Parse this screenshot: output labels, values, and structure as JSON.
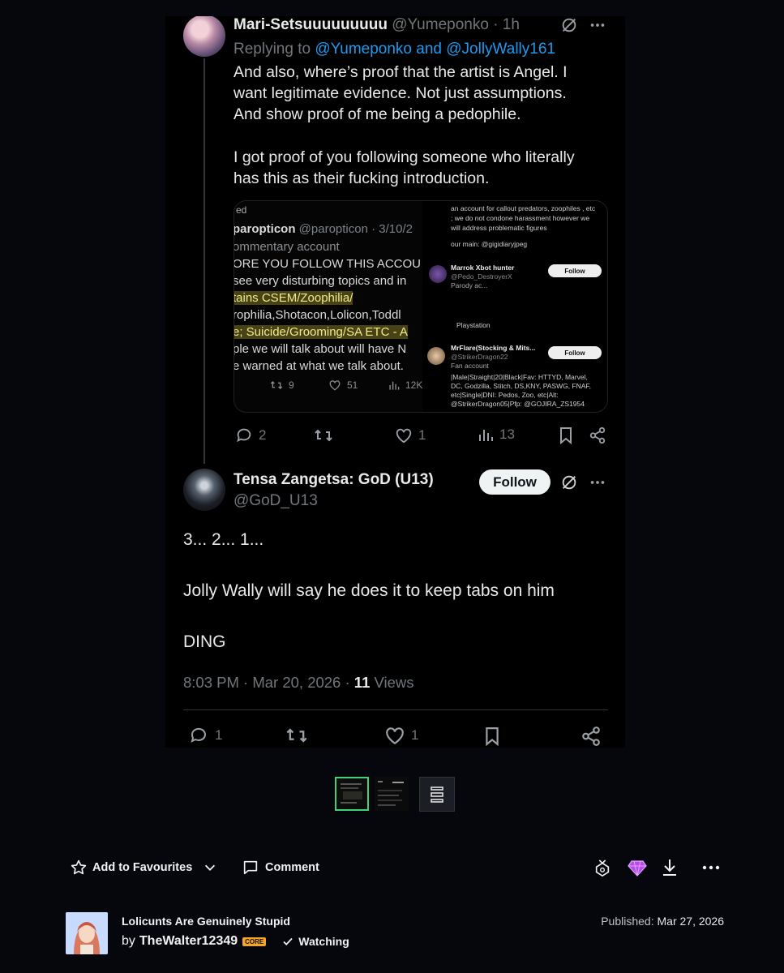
{
  "tweet1": {
    "author": "Mari-Setsuuuuuuuuu",
    "handle": "@Yumeponko",
    "time": "· 1h",
    "replying_prefix": "Replying to",
    "replying_to": "@Yumeponko and @JollyWally161",
    "lines": [
      "And also, where’s proof that the artist is Angel. I",
      "want legitimate evidence. Not just assumptions.",
      "And show proof of me being a pedophile.",
      "I got proof of you following someone who literally",
      "has this as their fucking introduction."
    ],
    "stats": {
      "replies": "2",
      "likes": "1",
      "views": "13"
    }
  },
  "quoted_image": {
    "left": {
      "top_label": "ed",
      "name": "paropticon",
      "handle_time": "@paropticon · 3/10/2",
      "lines": [
        "ommentary account",
        "ORE YOU FOLLOW THIS ACCOU",
        "see very disturbing topics and in",
        "tains CSEM/Zoophilia/",
        "rophilia,Shotacon,Lolicon,Toddl",
        "e; Suicide/Grooming/SA ETC - A",
        "ple we will talk about will have N",
        "e warned at what we talk about."
      ],
      "stats": {
        "retweets": "9",
        "likes": "51",
        "views": "12K"
      }
    },
    "right": {
      "intro_lines": [
        "an account for callout predators, zoophiles , etc",
        "; we do not condone harassment however we",
        "will address problematic figures",
        "our main: @gigidiaryjpeg"
      ],
      "user1_name": "Marrok Xbot hunter",
      "user1_handle": "@Pedo_DestroyerX",
      "user1_bio": "Parody ac...",
      "user1_extra": "Playstation",
      "user2_name": "MrFlare(Stocking & Mits...",
      "user2_handle": "@StrikerDragon22",
      "user2_bio": "Fan account",
      "user2_lines": [
        "|Male|Straight|20|Black|Fav: HTTYD, Marvel,",
        "DC, Godzilla, Stitch, DS,KNY, PASWG, FNAF,",
        "etc|Single|DNI: Pedos, Zoo, etc|Alt:",
        "@StrikerDragon05|Pfp: @GOJIRA_ZS1954"
      ],
      "follow_label": "Follow"
    }
  },
  "tweet2": {
    "author": "Tensa Zangetsa: GoD (U13)",
    "handle": "@GoD_U13",
    "follow_label": "Follow",
    "lines": [
      "3... 2... 1...",
      "Jolly Wally will say he does it to keep tabs on him",
      "DING"
    ],
    "time": "8:03 PM · Mar 20, 2026 ·",
    "views_count": "11",
    "views_label": "Views",
    "stats": {
      "replies": "1",
      "likes": "1"
    }
  },
  "actions": {
    "favourite": "Add to Favourites",
    "comment": "Comment"
  },
  "footer": {
    "title": "Lolicunts Are Genuinely Stupid",
    "by": "by",
    "artist": "TheWalter12349",
    "badge": "CORE",
    "watching": "Watching",
    "published_label": "Published:",
    "published_date": "Mar 27, 2026"
  }
}
